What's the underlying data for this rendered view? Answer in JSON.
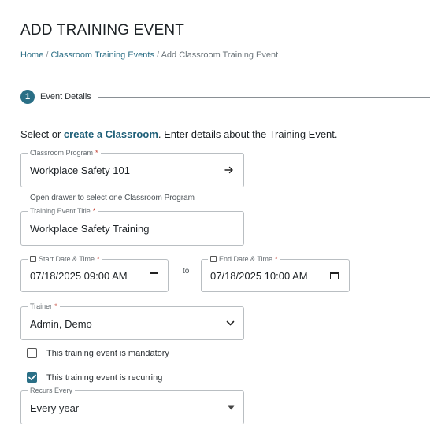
{
  "page": {
    "title": "ADD TRAINING EVENT"
  },
  "breadcrumb": {
    "home": "Home",
    "separator": "/",
    "classroom_events": "Classroom Training Events",
    "current": "Add Classroom Training Event"
  },
  "stepper": {
    "number": "1",
    "label": "Event Details"
  },
  "intro": {
    "prefix": "Select or ",
    "link": "create a Classroom",
    "suffix": ". Enter details about the Training Event."
  },
  "form": {
    "required_marker": "*",
    "classroom_program": {
      "label": "Classroom Program",
      "value": "Workplace Safety 101",
      "icon": "arrow-right-icon",
      "helper": "Open drawer to select one Classroom Program"
    },
    "event_title": {
      "label": "Training Event Title",
      "value": "Workplace Safety Training"
    },
    "start": {
      "label": "Start Date & Time",
      "value": "07/18/2025 09:00 AM",
      "icon": "calendar-icon"
    },
    "to_label": "to",
    "end": {
      "label": "End Date & Time",
      "value": "07/18/2025 10:00 AM",
      "icon": "calendar-icon"
    },
    "trainer": {
      "label": "Trainer",
      "value": "Admin, Demo",
      "icon": "chevron-down-icon"
    },
    "mandatory": {
      "label": "This training event is mandatory",
      "checked": false
    },
    "recurring": {
      "label": "This training event is recurring",
      "checked": true
    },
    "recurs_every": {
      "label": "Recurs Every",
      "value": "Every year",
      "icon": "dropdown-caret-icon"
    }
  },
  "colors": {
    "accent": "#2a6f86",
    "link": "#1e5f78",
    "required": "#c0392b",
    "border": "#b9bec2"
  }
}
